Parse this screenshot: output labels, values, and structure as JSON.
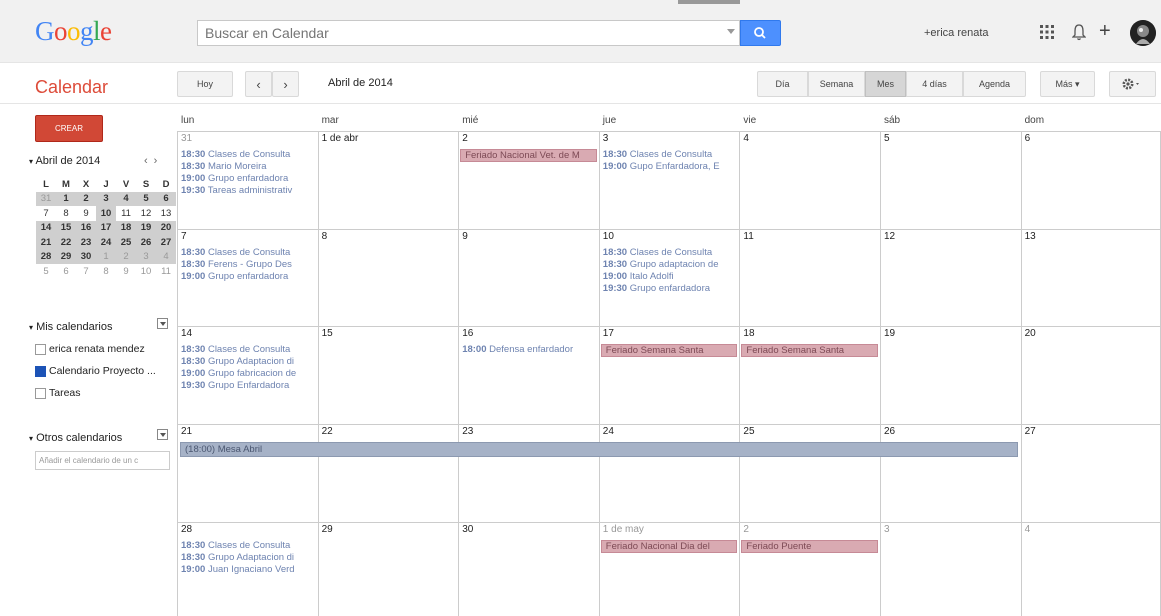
{
  "topbar": {
    "logo": "Google",
    "search_placeholder": "Buscar en Calendar",
    "user": "+erica renata"
  },
  "toolbar": {
    "app_title": "Calendar",
    "today": "Hoy",
    "current_month": "Abril de 2014",
    "views": [
      "Día",
      "Semana",
      "Mes",
      "4 días",
      "Agenda"
    ],
    "active_view": "Mes",
    "more": "Más ▾"
  },
  "sidebar": {
    "create": "CREAR",
    "mini_title": "Abril de 2014",
    "mini_dow": [
      "L",
      "M",
      "X",
      "J",
      "V",
      "S",
      "D"
    ],
    "mini_weeks": [
      [
        "31",
        "1",
        "2",
        "3",
        "4",
        "5",
        "6"
      ],
      [
        "7",
        "8",
        "9",
        "10",
        "11",
        "12",
        "13"
      ],
      [
        "14",
        "15",
        "16",
        "17",
        "18",
        "19",
        "20"
      ],
      [
        "21",
        "22",
        "23",
        "24",
        "25",
        "26",
        "27"
      ],
      [
        "28",
        "29",
        "30",
        "1",
        "2",
        "3",
        "4"
      ],
      [
        "5",
        "6",
        "7",
        "8",
        "9",
        "10",
        "11"
      ]
    ],
    "my_calendars_title": "Mis calendarios",
    "my_calendars": [
      {
        "label": "erica renata mendez",
        "checked": false
      },
      {
        "label": "Calendario Proyecto ...",
        "checked": true
      },
      {
        "label": "Tareas",
        "checked": false
      }
    ],
    "other_calendars_title": "Otros calendarios",
    "add_placeholder": "Añadir el calendario de un c"
  },
  "calendar": {
    "dow": [
      "lun",
      "mar",
      "mié",
      "jue",
      "vie",
      "sáb",
      "dom"
    ],
    "weeks": [
      {
        "days": [
          "31",
          "1 de abr",
          "2",
          "3",
          "4",
          "5",
          "6"
        ],
        "events": [
          {
            "col": 0,
            "slot": 0,
            "time": "18:30",
            "title": "Clases de Consulta"
          },
          {
            "col": 0,
            "slot": 1,
            "time": "18:30",
            "title": "Mario Moreira"
          },
          {
            "col": 0,
            "slot": 2,
            "time": "19:00",
            "title": "Grupo enfardadora"
          },
          {
            "col": 0,
            "slot": 3,
            "time": "19:30",
            "title": "Tareas administrativ"
          },
          {
            "col": 3,
            "slot": 0,
            "time": "18:30",
            "title": "Clases de Consulta"
          },
          {
            "col": 3,
            "slot": 1,
            "time": "19:00",
            "title": "Gupo Enfardadora, E"
          }
        ],
        "holidays": [
          {
            "col": 2,
            "span": 1,
            "slot": 0,
            "title": "Feriado Nacional Vet. de M"
          }
        ]
      },
      {
        "days": [
          "7",
          "8",
          "9",
          "10",
          "11",
          "12",
          "13"
        ],
        "events": [
          {
            "col": 0,
            "slot": 0,
            "time": "18:30",
            "title": "Clases de Consulta"
          },
          {
            "col": 0,
            "slot": 1,
            "time": "18:30",
            "title": "Ferens - Grupo Des"
          },
          {
            "col": 0,
            "slot": 2,
            "time": "19:00",
            "title": "Grupo enfardadora"
          },
          {
            "col": 3,
            "slot": 0,
            "time": "18:30",
            "title": "Clases de Consulta"
          },
          {
            "col": 3,
            "slot": 1,
            "time": "18:30",
            "title": "Grupo adaptacion de"
          },
          {
            "col": 3,
            "slot": 2,
            "time": "19:00",
            "title": "Italo Adolfi"
          },
          {
            "col": 3,
            "slot": 3,
            "time": "19:30",
            "title": "Grupo enfardadora"
          }
        ],
        "holidays": []
      },
      {
        "days": [
          "14",
          "15",
          "16",
          "17",
          "18",
          "19",
          "20"
        ],
        "events": [
          {
            "col": 0,
            "slot": 0,
            "time": "18:30",
            "title": "Clases de Consulta"
          },
          {
            "col": 0,
            "slot": 1,
            "time": "18:30",
            "title": "Grupo Adaptacion di"
          },
          {
            "col": 0,
            "slot": 2,
            "time": "19:00",
            "title": "Grupo fabricacion de"
          },
          {
            "col": 0,
            "slot": 3,
            "time": "19:30",
            "title": "Grupo Enfardadora"
          },
          {
            "col": 2,
            "slot": 0,
            "time": "18:00",
            "title": "Defensa enfardador"
          }
        ],
        "holidays": [
          {
            "col": 3,
            "span": 1,
            "slot": 0,
            "title": "Feriado Semana Santa"
          },
          {
            "col": 4,
            "span": 1,
            "slot": 0,
            "title": "Feriado Semana Santa"
          }
        ]
      },
      {
        "days": [
          "21",
          "22",
          "23",
          "24",
          "25",
          "26",
          "27"
        ],
        "events": [],
        "holidays": []
      },
      {
        "days": [
          "28",
          "29",
          "30",
          "1 de may",
          "2",
          "3",
          "4"
        ],
        "events": [
          {
            "col": 0,
            "slot": 0,
            "time": "18:30",
            "title": "Clases de Consulta"
          },
          {
            "col": 0,
            "slot": 1,
            "time": "18:30",
            "title": "Grupo Adaptacion di"
          },
          {
            "col": 0,
            "slot": 2,
            "time": "19:00",
            "title": "Juan Ignaciano Verd"
          }
        ],
        "holidays": [
          {
            "col": 3,
            "span": 1,
            "slot": 0,
            "title": "Feriado Nacional Dia del"
          },
          {
            "col": 4,
            "span": 1,
            "slot": 0,
            "title": "Feriado Puente"
          }
        ]
      }
    ],
    "allday_event": "(18:00) Mesa Abril",
    "colors": {
      "event_text": "#6e83b0",
      "holiday_bg": "#d9aab2",
      "allday_bg": "#a6b2c7"
    }
  }
}
